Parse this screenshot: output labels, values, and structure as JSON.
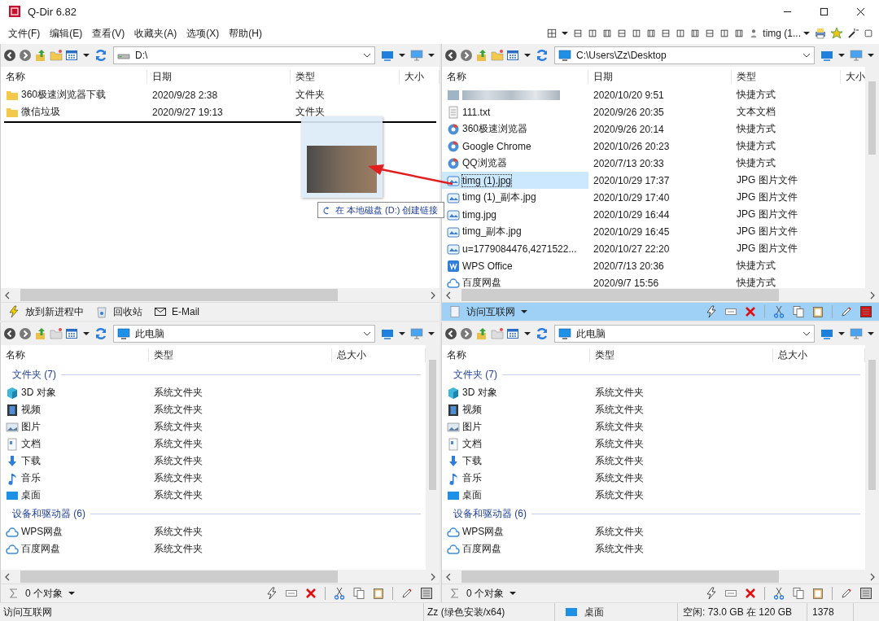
{
  "window": {
    "title": "Q-Dir 6.82"
  },
  "menu": [
    "文件(F)",
    "编辑(E)",
    "查看(V)",
    "收藏夹(A)",
    "选项(X)",
    "帮助(H)"
  ],
  "quick_access": {
    "label": "timg (1..."
  },
  "panes": [
    {
      "active": false,
      "address": {
        "kind": "drive",
        "text": "D:\\"
      },
      "columns": [
        "名称",
        "日期",
        "类型",
        "大小"
      ],
      "rows": [
        {
          "kind": "folder",
          "name": "360极速浏览器下载",
          "cols": [
            "2020/9/28 2:38",
            "文件夹"
          ],
          "selected": false
        },
        {
          "kind": "folder",
          "name": "微信垃圾",
          "cols": [
            "2020/9/27 19:13",
            "文件夹"
          ],
          "selected": false
        }
      ],
      "bar": {
        "kind": "actions",
        "items": [
          {
            "kind": "lightning",
            "label": "放到新进程中"
          },
          {
            "kind": "recycle",
            "label": "回收站"
          },
          {
            "kind": "mail",
            "label": "E-Mail"
          }
        ]
      }
    },
    {
      "active": true,
      "address": {
        "kind": "monitor",
        "text": "C:\\Users\\Zz\\Desktop"
      },
      "columns": [
        "名称",
        "日期",
        "类型",
        "大小"
      ],
      "rows": [
        {
          "kind": "blurred",
          "cols": [
            "2020/10/20 9:51",
            "快捷方式"
          ],
          "selected": false
        },
        {
          "kind": "text",
          "name": "111.txt",
          "cols": [
            "2020/9/26 20:35",
            "文本文档"
          ],
          "selected": false
        },
        {
          "kind": "browser",
          "name": "360极速浏览器",
          "cols": [
            "2020/9/26 20:14",
            "快捷方式"
          ],
          "selected": false
        },
        {
          "kind": "browser",
          "name": "Google Chrome",
          "cols": [
            "2020/10/26 20:23",
            "快捷方式"
          ],
          "selected": false
        },
        {
          "kind": "browser",
          "name": "QQ浏览器",
          "cols": [
            "2020/7/13 20:33",
            "快捷方式"
          ],
          "selected": false
        },
        {
          "kind": "image",
          "name": "timg (1).jpg",
          "cols": [
            "2020/10/29 17:37",
            "JPG 图片文件"
          ],
          "selected": true
        },
        {
          "kind": "image",
          "name": "timg (1)_副本.jpg",
          "cols": [
            "2020/10/29 17:40",
            "JPG 图片文件"
          ],
          "selected": false
        },
        {
          "kind": "image",
          "name": "timg.jpg",
          "cols": [
            "2020/10/29 16:44",
            "JPG 图片文件"
          ],
          "selected": false
        },
        {
          "kind": "image",
          "name": "timg_副本.jpg",
          "cols": [
            "2020/10/29 16:45",
            "JPG 图片文件"
          ],
          "selected": false
        },
        {
          "kind": "image",
          "name": "u=1779084476,4271522...",
          "cols": [
            "2020/10/27 22:20",
            "JPG 图片文件"
          ],
          "selected": false
        },
        {
          "kind": "app",
          "name": "WPS Office",
          "cols": [
            "2020/7/13 20:36",
            "快捷方式"
          ],
          "selected": false
        },
        {
          "kind": "cloud",
          "name": "百度网盘",
          "cols": [
            "2020/9/7 15:56",
            "快捷方式"
          ],
          "selected": false
        }
      ],
      "bar": {
        "kind": "link",
        "label": "访问互联网"
      }
    },
    {
      "active": false,
      "address": {
        "kind": "monitor",
        "text": "此电脑"
      },
      "columns": [
        "名称",
        "类型",
        "总大小"
      ],
      "groups": [
        {
          "title": "文件夹 (7)",
          "items": [
            {
              "kind": "cube",
              "name": "3D 对象",
              "cols": [
                "系统文件夹"
              ],
              "selected": false
            },
            {
              "kind": "video",
              "name": "视频",
              "cols": [
                "系统文件夹"
              ],
              "selected": false
            },
            {
              "kind": "picture",
              "name": "图片",
              "cols": [
                "系统文件夹"
              ],
              "selected": false
            },
            {
              "kind": "doc",
              "name": "文档",
              "cols": [
                "系统文件夹"
              ],
              "selected": false
            },
            {
              "kind": "download",
              "name": "下载",
              "cols": [
                "系统文件夹"
              ],
              "selected": false
            },
            {
              "kind": "music",
              "name": "音乐",
              "cols": [
                "系统文件夹"
              ],
              "selected": false
            },
            {
              "kind": "desktop",
              "name": "桌面",
              "cols": [
                "系统文件夹"
              ],
              "selected": false
            }
          ]
        },
        {
          "title": "设备和驱动器 (6)",
          "items": [
            {
              "kind": "cloud",
              "name": "WPS网盘",
              "cols": [
                "系统文件夹"
              ],
              "selected": false
            },
            {
              "kind": "cloud",
              "name": "百度网盘",
              "cols": [
                "系统文件夹"
              ],
              "selected": false
            }
          ]
        }
      ],
      "bar": {
        "kind": "count",
        "label": "0 个对象"
      }
    },
    {
      "active": false,
      "address": {
        "kind": "monitor",
        "text": "此电脑"
      },
      "columns": [
        "名称",
        "类型",
        "总大小"
      ],
      "groups": [
        {
          "title": "文件夹 (7)",
          "items": [
            {
              "kind": "cube",
              "name": "3D 对象",
              "cols": [
                "系统文件夹"
              ],
              "selected": false
            },
            {
              "kind": "video",
              "name": "视频",
              "cols": [
                "系统文件夹"
              ],
              "selected": false
            },
            {
              "kind": "picture",
              "name": "图片",
              "cols": [
                "系统文件夹"
              ],
              "selected": false
            },
            {
              "kind": "doc",
              "name": "文档",
              "cols": [
                "系统文件夹"
              ],
              "selected": false
            },
            {
              "kind": "download",
              "name": "下载",
              "cols": [
                "系统文件夹"
              ],
              "selected": false
            },
            {
              "kind": "music",
              "name": "音乐",
              "cols": [
                "系统文件夹"
              ],
              "selected": false
            },
            {
              "kind": "desktop",
              "name": "桌面",
              "cols": [
                "系统文件夹"
              ],
              "selected": false
            }
          ]
        },
        {
          "title": "设备和驱动器 (6)",
          "items": [
            {
              "kind": "cloud",
              "name": "WPS网盘",
              "cols": [
                "系统文件夹"
              ],
              "selected": false
            },
            {
              "kind": "cloud",
              "name": "百度网盘",
              "cols": [
                "系统文件夹"
              ],
              "selected": false
            }
          ]
        }
      ],
      "bar": {
        "kind": "count",
        "label": "0 个对象"
      }
    }
  ],
  "drag_overlay": {
    "tooltip": "在 本地磁盘 (D:) 创建链接"
  },
  "status_bar": [
    {
      "text": "访问互联网"
    },
    {
      "text": "Zz (绿色安装/x64)"
    },
    {
      "kind": "desktop",
      "text": "桌面"
    },
    {
      "text": "空闲: 73.0 GB 在 120 GB"
    },
    {
      "text": "1378"
    }
  ]
}
